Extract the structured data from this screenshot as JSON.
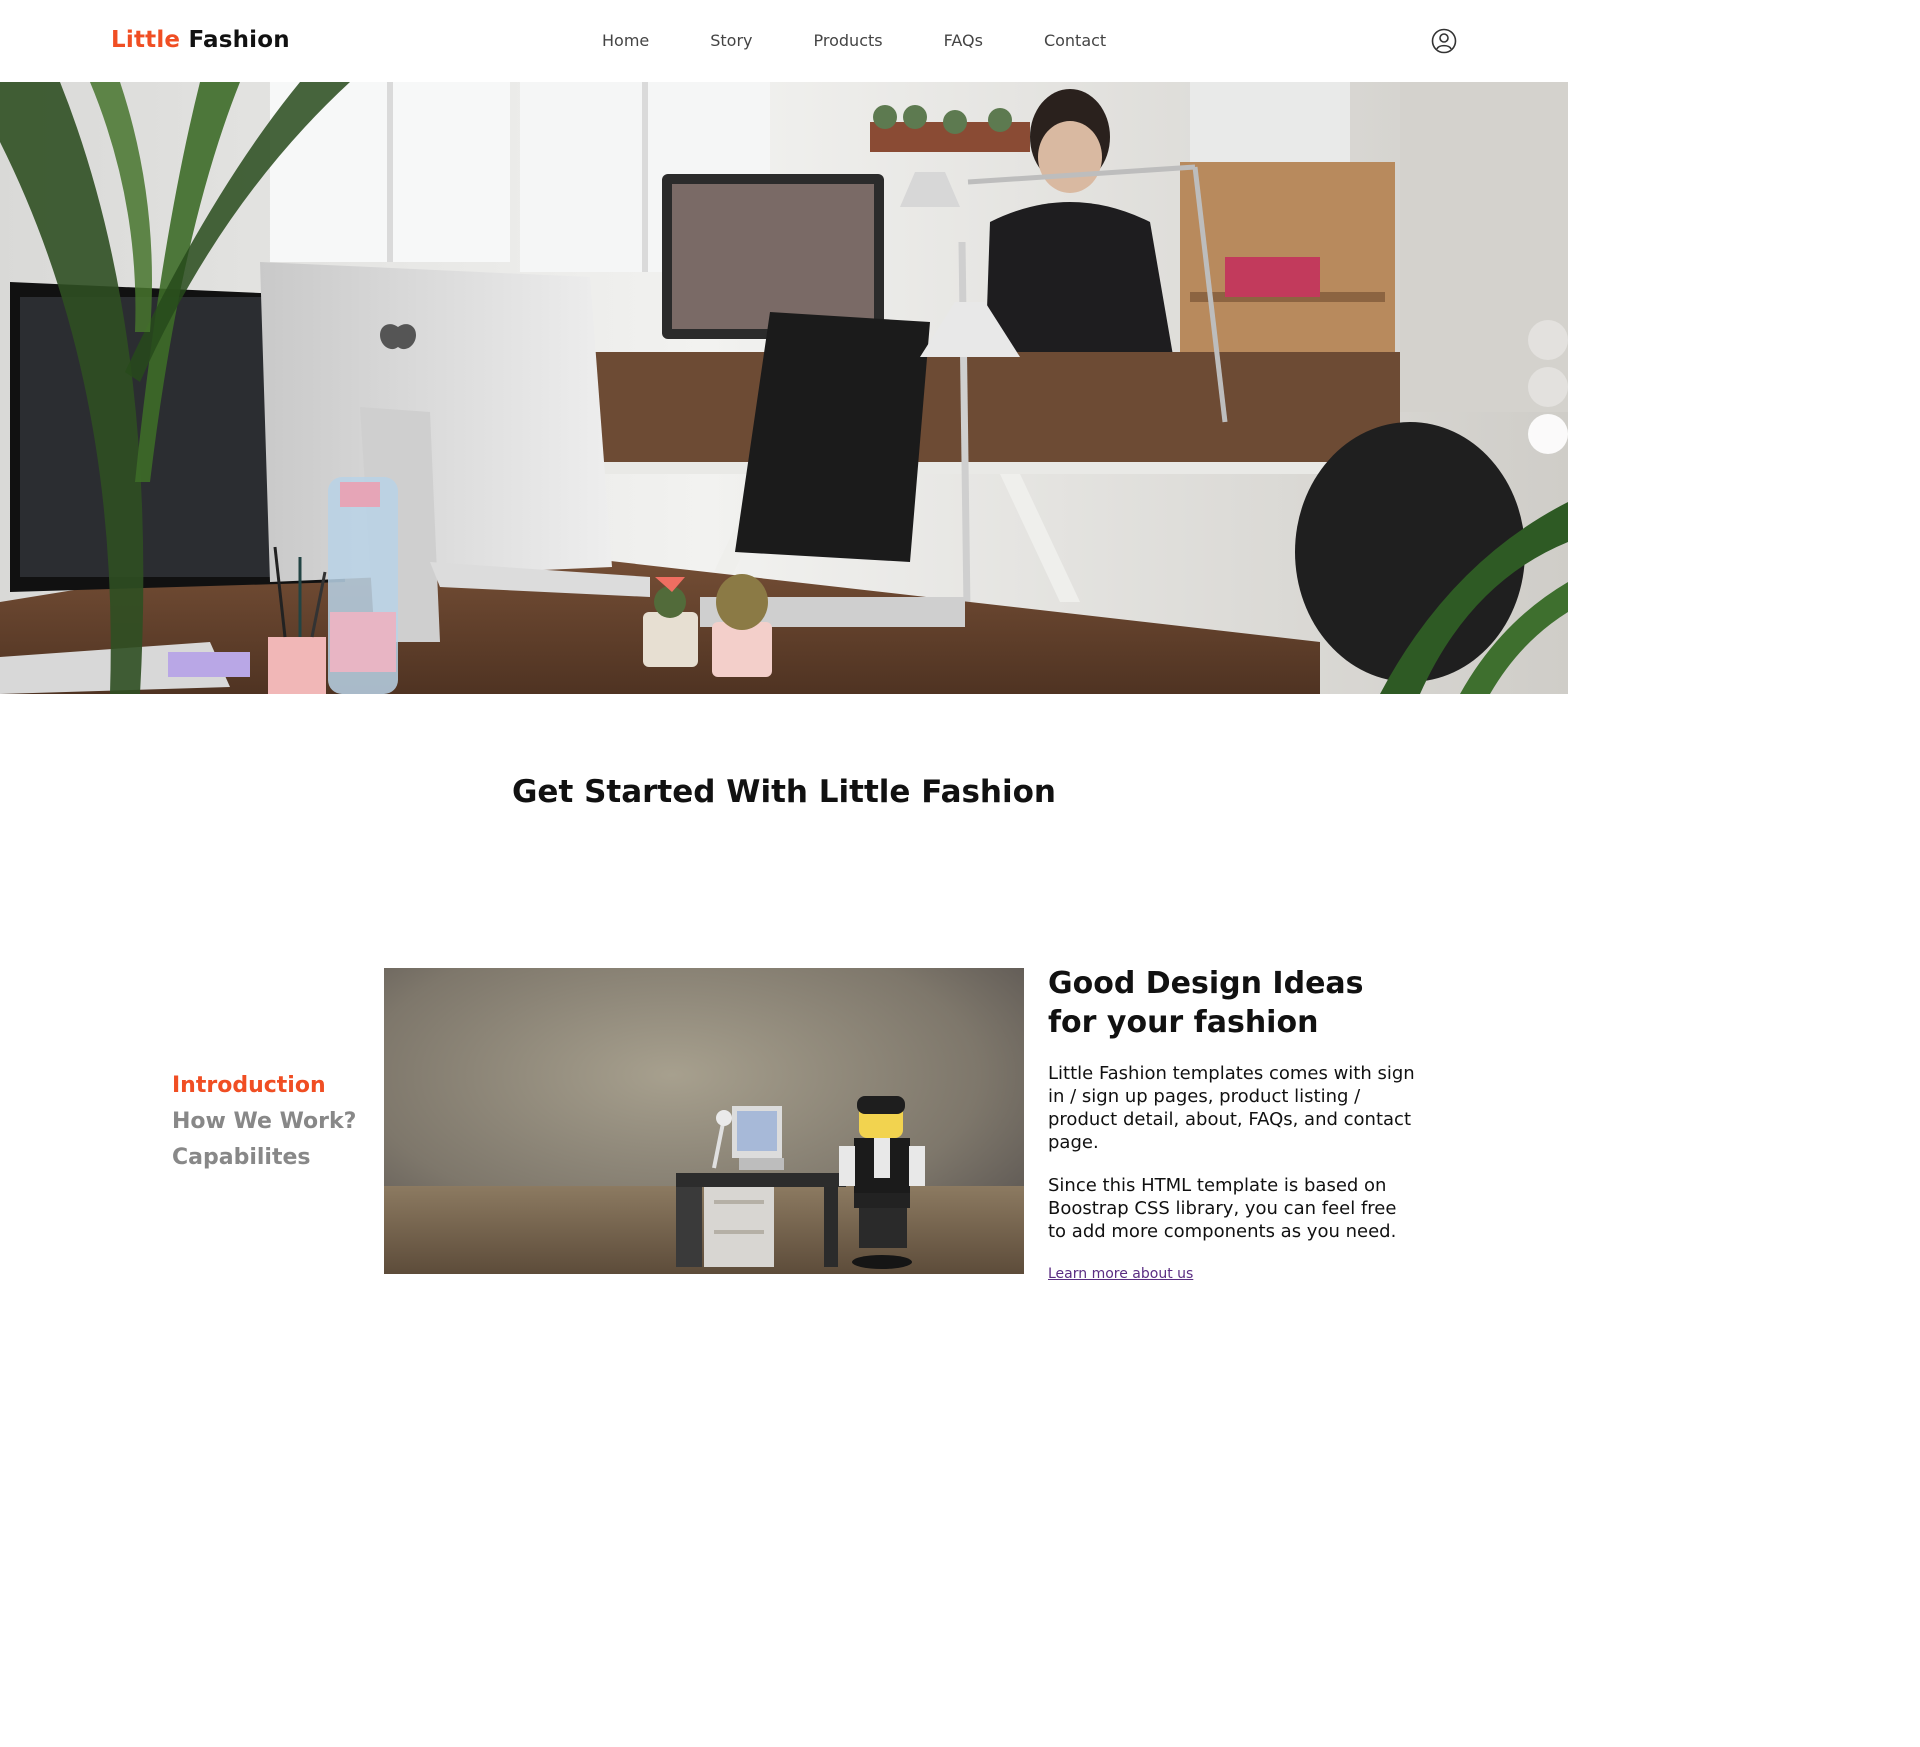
{
  "brand": {
    "accent": "Little",
    "rest": "Fashion"
  },
  "nav": {
    "links": [
      "Home",
      "Story",
      "Products",
      "FAQs",
      "Contact"
    ],
    "user_icon": "user-circle-icon"
  },
  "hero": {
    "carousel_dots": 3,
    "active_dot": 3
  },
  "section_title": "Get Started With Little Fashion",
  "sidebar": {
    "items": [
      "Introduction",
      "How We Work?",
      "Capabilites"
    ],
    "active": "Introduction"
  },
  "intro": {
    "heading": "Good Design Ideas for your fashion",
    "paragraph_1": "Little Fashion templates comes with sign in / sign up pages, product listing / product detail, about, FAQs, and contact page.",
    "paragraph_2": "Since this HTML template is based on Boostrap CSS library, you can feel free to add more components as you need.",
    "link": "Learn more about us"
  },
  "colors": {
    "accent": "#f04e23",
    "nav_text": "#444444",
    "muted": "#888888",
    "link": "#5a2d82"
  }
}
